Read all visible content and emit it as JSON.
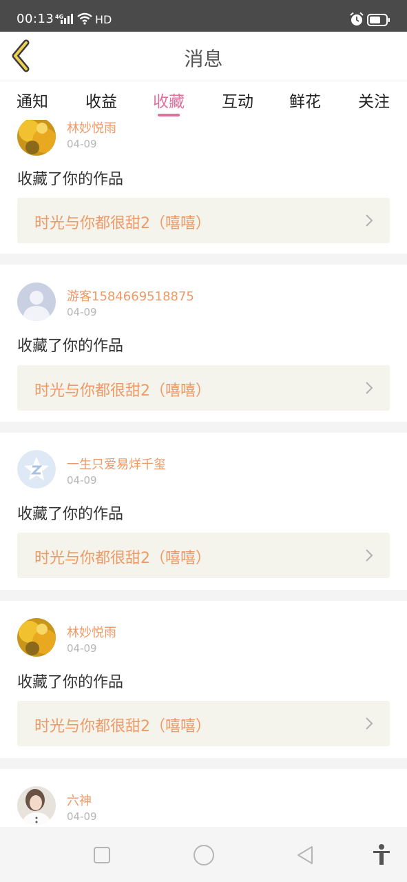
{
  "status_bar": {
    "time": "00:13",
    "network": "4G",
    "hd": "HD",
    "icons": [
      "signal-icon",
      "wifi-icon",
      "alarm-icon",
      "battery-icon"
    ]
  },
  "header": {
    "title": "消息",
    "back_icon": "chevron-left-icon"
  },
  "tabs": [
    {
      "label": "通知",
      "active": false
    },
    {
      "label": "收益",
      "active": false
    },
    {
      "label": "收藏",
      "active": true
    },
    {
      "label": "互动",
      "active": false
    },
    {
      "label": "鲜花",
      "active": false
    },
    {
      "label": "关注",
      "active": false
    }
  ],
  "messages": [
    {
      "user": "林妙悦雨",
      "date": "04-09",
      "action": "收藏了你的作品",
      "work": "时光与你都很甜2（嘻嘻）",
      "avatar": "sunflower-avatar"
    },
    {
      "user": "游客1584669518875",
      "date": "04-09",
      "action": "收藏了你的作品",
      "work": "时光与你都很甜2（嘻嘻）",
      "avatar": "default-person-avatar"
    },
    {
      "user": "一生只爱易烊千玺",
      "date": "04-09",
      "action": "收藏了你的作品",
      "work": "时光与你都很甜2（嘻嘻）",
      "avatar": "star-badge-avatar"
    },
    {
      "user": "林妙悦雨",
      "date": "04-09",
      "action": "收藏了你的作品",
      "work": "时光与你都很甜2（嘻嘻）",
      "avatar": "sunflower-avatar"
    },
    {
      "user": "六神",
      "date": "04-09",
      "action": "",
      "work": "",
      "avatar": "photo-avatar"
    }
  ],
  "colors": {
    "accent": "#e2709c",
    "username": "#ee9966",
    "status_bar": "#4a4a4a",
    "work_bg": "#f4f4ec"
  },
  "nav_bar": {
    "icons": [
      "recents-square-icon",
      "home-circle-icon",
      "back-triangle-icon",
      "accessibility-icon"
    ]
  }
}
